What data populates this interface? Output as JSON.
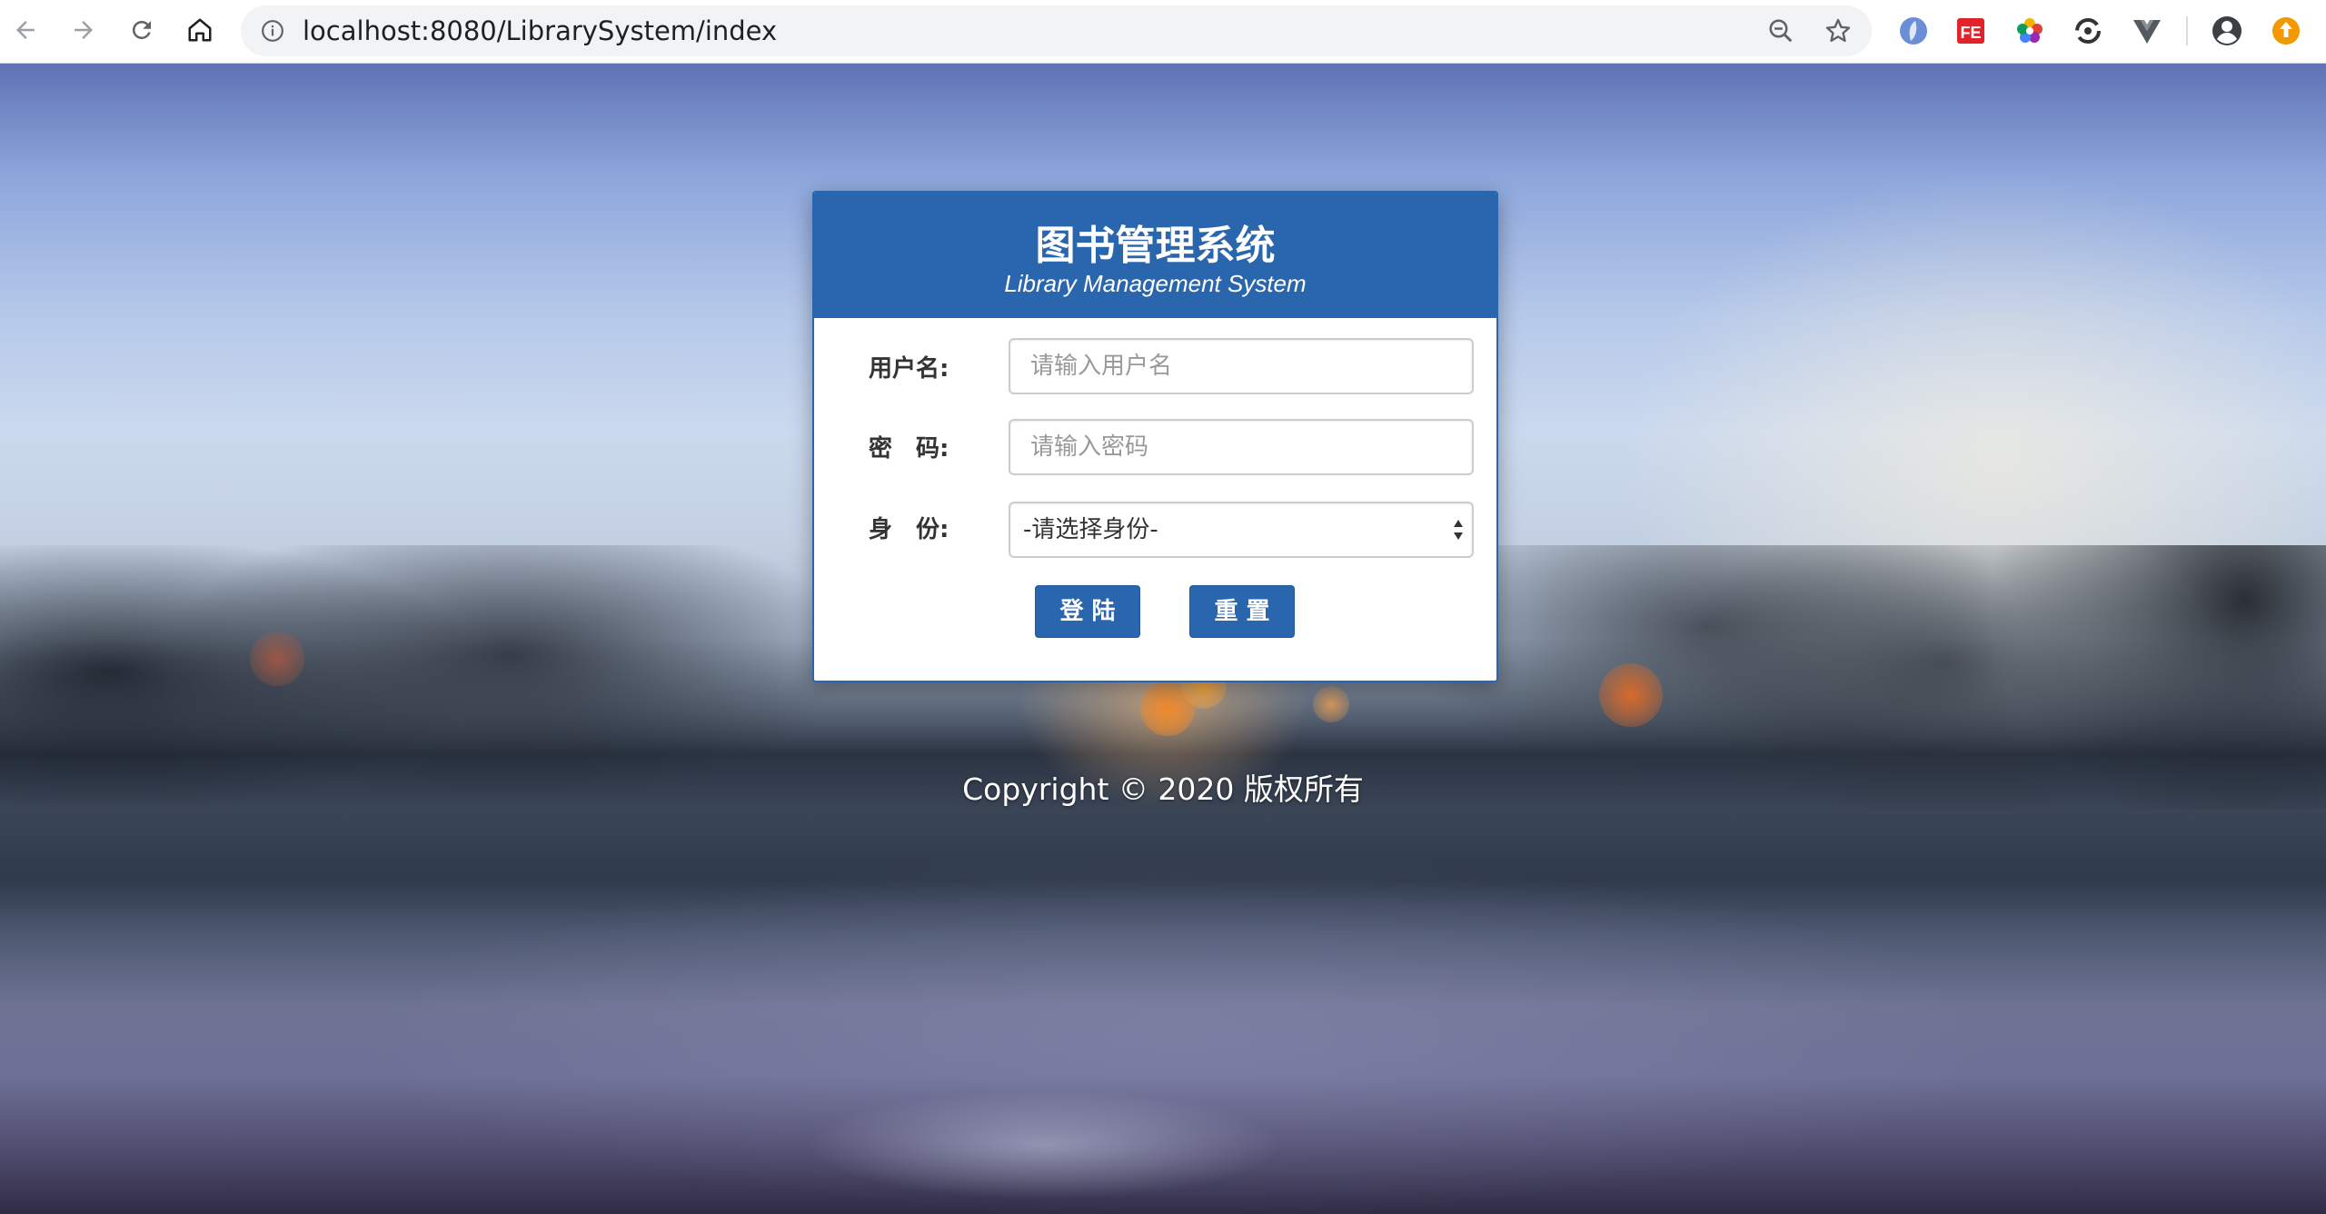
{
  "browser": {
    "url": "localhost:8080/LibrarySystem/index"
  },
  "login": {
    "title": "图书管理系统",
    "subtitle": "Library Management System",
    "username_label": "用户名:",
    "username_placeholder": "请输入用户名",
    "password_label": "密　码:",
    "password_placeholder": "请输入密码",
    "role_label": "身　份:",
    "role_selected": "-请选择身份-",
    "login_button": "登 陆",
    "reset_button": "重 置"
  },
  "footer": {
    "copyright": "Copyright © 2020 版权所有"
  },
  "colors": {
    "primary": "#2a66ad"
  }
}
